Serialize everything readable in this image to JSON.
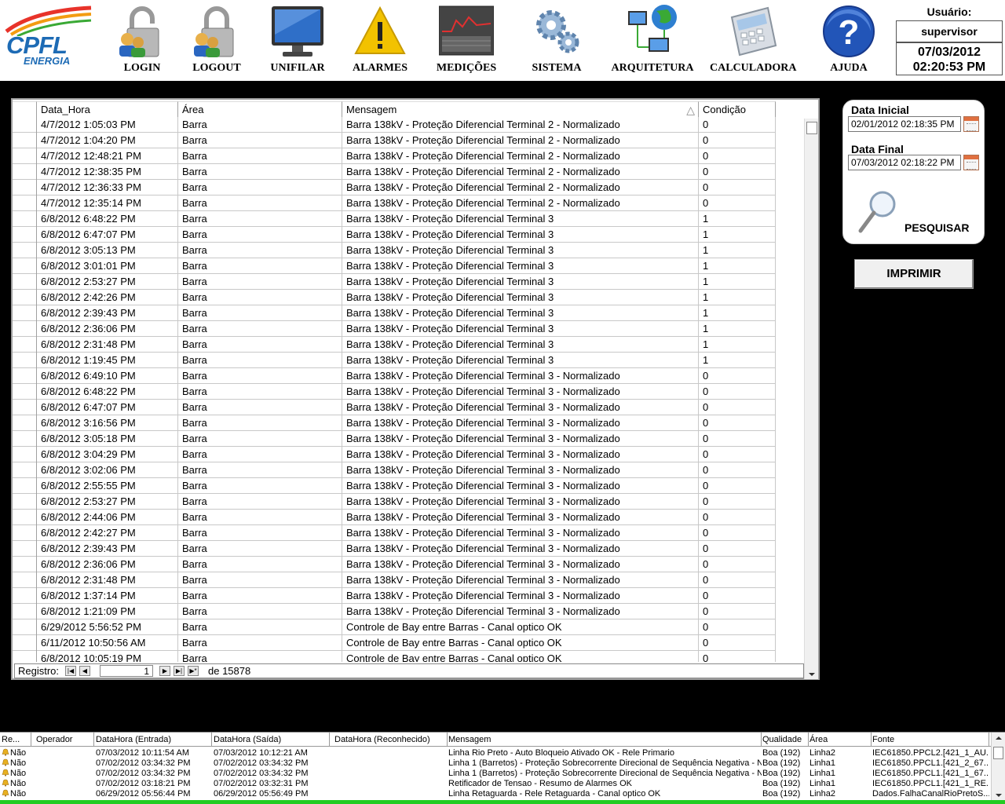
{
  "brand": {
    "main": "CPFL",
    "sub": "ENERGIA"
  },
  "toolbar": [
    {
      "key": "login",
      "label": "LOGIN",
      "icon": "padlock-users-icon"
    },
    {
      "key": "logout",
      "label": "LOGOUT",
      "icon": "padlock-users-icon"
    },
    {
      "key": "unifilar",
      "label": "UNIFILAR",
      "icon": "monitor-icon"
    },
    {
      "key": "alarmes",
      "label": "ALARMES",
      "icon": "warning-icon"
    },
    {
      "key": "medicoes",
      "label": "MEDIÇÕES",
      "icon": "measurement-display-icon"
    },
    {
      "key": "sistema",
      "label": "SISTEMA",
      "icon": "gears-icon"
    },
    {
      "key": "arquitetura",
      "label": "ARQUITETURA",
      "icon": "network-globe-icon"
    },
    {
      "key": "calculadora",
      "label": "CALCULADORA",
      "icon": "calculator-icon"
    },
    {
      "key": "ajuda",
      "label": "AJUDA",
      "icon": "help-icon"
    }
  ],
  "user": {
    "label": "Usuário:",
    "name": "supervisor",
    "date": "07/03/2012",
    "time": "02:20:53 PM"
  },
  "grid": {
    "columns": [
      "Data_Hora",
      "Área",
      "Mensagem",
      "Condição"
    ],
    "sort_indicator": "△",
    "rows": [
      [
        "4/7/2012 1:05:03 PM",
        "Barra",
        "Barra 138kV - Proteção Diferencial Terminal 2 - Normalizado",
        "0"
      ],
      [
        "4/7/2012 1:04:20 PM",
        "Barra",
        "Barra 138kV - Proteção Diferencial Terminal 2 - Normalizado",
        "0"
      ],
      [
        "4/7/2012 12:48:21 PM",
        "Barra",
        "Barra 138kV - Proteção Diferencial Terminal 2 - Normalizado",
        "0"
      ],
      [
        "4/7/2012 12:38:35 PM",
        "Barra",
        "Barra 138kV - Proteção Diferencial Terminal 2 - Normalizado",
        "0"
      ],
      [
        "4/7/2012 12:36:33 PM",
        "Barra",
        "Barra 138kV - Proteção Diferencial Terminal 2 - Normalizado",
        "0"
      ],
      [
        "4/7/2012 12:35:14 PM",
        "Barra",
        "Barra 138kV - Proteção Diferencial Terminal 2 - Normalizado",
        "0"
      ],
      [
        "6/8/2012 6:48:22 PM",
        "Barra",
        "Barra 138kV - Proteção Diferencial Terminal 3",
        "1"
      ],
      [
        "6/8/2012 6:47:07 PM",
        "Barra",
        "Barra 138kV - Proteção Diferencial Terminal 3",
        "1"
      ],
      [
        "6/8/2012 3:05:13 PM",
        "Barra",
        "Barra 138kV - Proteção Diferencial Terminal 3",
        "1"
      ],
      [
        "6/8/2012 3:01:01 PM",
        "Barra",
        "Barra 138kV - Proteção Diferencial Terminal 3",
        "1"
      ],
      [
        "6/8/2012 2:53:27 PM",
        "Barra",
        "Barra 138kV - Proteção Diferencial Terminal 3",
        "1"
      ],
      [
        "6/8/2012 2:42:26 PM",
        "Barra",
        "Barra 138kV - Proteção Diferencial Terminal 3",
        "1"
      ],
      [
        "6/8/2012 2:39:43 PM",
        "Barra",
        "Barra 138kV - Proteção Diferencial Terminal 3",
        "1"
      ],
      [
        "6/8/2012 2:36:06 PM",
        "Barra",
        "Barra 138kV - Proteção Diferencial Terminal 3",
        "1"
      ],
      [
        "6/8/2012 2:31:48 PM",
        "Barra",
        "Barra 138kV - Proteção Diferencial Terminal 3",
        "1"
      ],
      [
        "6/8/2012 1:19:45 PM",
        "Barra",
        "Barra 138kV - Proteção Diferencial Terminal 3",
        "1"
      ],
      [
        "6/8/2012 6:49:10 PM",
        "Barra",
        "Barra 138kV - Proteção Diferencial Terminal 3 - Normalizado",
        "0"
      ],
      [
        "6/8/2012 6:48:22 PM",
        "Barra",
        "Barra 138kV - Proteção Diferencial Terminal 3 - Normalizado",
        "0"
      ],
      [
        "6/8/2012 6:47:07 PM",
        "Barra",
        "Barra 138kV - Proteção Diferencial Terminal 3 - Normalizado",
        "0"
      ],
      [
        "6/8/2012 3:16:56 PM",
        "Barra",
        "Barra 138kV - Proteção Diferencial Terminal 3 - Normalizado",
        "0"
      ],
      [
        "6/8/2012 3:05:18 PM",
        "Barra",
        "Barra 138kV - Proteção Diferencial Terminal 3 - Normalizado",
        "0"
      ],
      [
        "6/8/2012 3:04:29 PM",
        "Barra",
        "Barra 138kV - Proteção Diferencial Terminal 3 - Normalizado",
        "0"
      ],
      [
        "6/8/2012 3:02:06 PM",
        "Barra",
        "Barra 138kV - Proteção Diferencial Terminal 3 - Normalizado",
        "0"
      ],
      [
        "6/8/2012 2:55:55 PM",
        "Barra",
        "Barra 138kV - Proteção Diferencial Terminal 3 - Normalizado",
        "0"
      ],
      [
        "6/8/2012 2:53:27 PM",
        "Barra",
        "Barra 138kV - Proteção Diferencial Terminal 3 - Normalizado",
        "0"
      ],
      [
        "6/8/2012 2:44:06 PM",
        "Barra",
        "Barra 138kV - Proteção Diferencial Terminal 3 - Normalizado",
        "0"
      ],
      [
        "6/8/2012 2:42:27 PM",
        "Barra",
        "Barra 138kV - Proteção Diferencial Terminal 3 - Normalizado",
        "0"
      ],
      [
        "6/8/2012 2:39:43 PM",
        "Barra",
        "Barra 138kV - Proteção Diferencial Terminal 3 - Normalizado",
        "0"
      ],
      [
        "6/8/2012 2:36:06 PM",
        "Barra",
        "Barra 138kV - Proteção Diferencial Terminal 3 - Normalizado",
        "0"
      ],
      [
        "6/8/2012 2:31:48 PM",
        "Barra",
        "Barra 138kV - Proteção Diferencial Terminal 3 - Normalizado",
        "0"
      ],
      [
        "6/8/2012 1:37:14 PM",
        "Barra",
        "Barra 138kV - Proteção Diferencial Terminal 3 - Normalizado",
        "0"
      ],
      [
        "6/8/2012 1:21:09 PM",
        "Barra",
        "Barra 138kV - Proteção Diferencial Terminal 3 - Normalizado",
        "0"
      ],
      [
        "6/29/2012 5:56:52 PM",
        "Barra",
        "Controle de Bay entre Barras - Canal optico OK",
        "0"
      ],
      [
        "6/11/2012 10:50:56 AM",
        "Barra",
        "Controle de Bay entre Barras - Canal optico OK",
        "0"
      ],
      [
        "6/8/2012 10:05:19 PM",
        "Barra",
        "Controle de Bay entre Barras - Canal optico OK",
        "0"
      ]
    ],
    "nav": {
      "label": "Registro:",
      "current": "1",
      "total_text": "de 15878"
    }
  },
  "search": {
    "start_label": "Data Inicial",
    "start_value": "02/01/2012 02:18:35 PM",
    "end_label": "Data Final",
    "end_value": "07/03/2012 02:18:22 PM",
    "button_label": "PESQUISAR",
    "print_label": "IMPRIMIR"
  },
  "alarms": {
    "columns": [
      "Re...",
      "Operador",
      "DataHora (Entrada)",
      "DataHora (Saída)",
      "DataHora (Reconhecido)",
      "Mensagem",
      "Qualidade",
      "Área",
      "Fonte"
    ],
    "rows": [
      [
        "Não",
        "",
        "07/03/2012 10:11:54 AM",
        "07/03/2012 10:12:21 AM",
        "",
        "Linha Rio Preto - Auto Bloqueio Ativado OK - Rele Primario",
        "Boa (192)",
        "Linha2",
        "IEC61850.PPCL2.[421_1_AU..."
      ],
      [
        "Não",
        "",
        "07/02/2012 03:34:32 PM",
        "07/02/2012 03:34:32 PM",
        "",
        "Linha 1 (Barretos) - Proteção Sobrecorrente Direcional de Sequência Negativa - N...",
        "Boa (192)",
        "Linha1",
        "IEC61850.PPCL1.[421_2_67..."
      ],
      [
        "Não",
        "",
        "07/02/2012 03:34:32 PM",
        "07/02/2012 03:34:32 PM",
        "",
        "Linha 1 (Barretos) - Proteção Sobrecorrente Direcional de Sequência Negativa - N...",
        "Boa (192)",
        "Linha1",
        "IEC61850.PPCL1.[421_1_67..."
      ],
      [
        "Não",
        "",
        "07/02/2012 03:18:21 PM",
        "07/02/2012 03:32:31 PM",
        "",
        "Retificador de Tensao - Resumo de Alarmes OK",
        "Boa (192)",
        "Linha1",
        "IEC61850.PPCL1.[421_1_RE..."
      ],
      [
        "Não",
        "",
        "06/29/2012 05:56:44 PM",
        "06/29/2012 05:56:49 PM",
        "",
        "Linha Retaguarda - Rele Retaguarda - Canal optico OK",
        "Boa (192)",
        "Linha2",
        "Dados.FalhaCanalRioPretoS...."
      ]
    ]
  },
  "colors": {
    "brand_blue": "#1d6bb5",
    "brand_red": "#e8332a",
    "brand_green": "#3aa935",
    "status_ok": "#22cc22"
  }
}
